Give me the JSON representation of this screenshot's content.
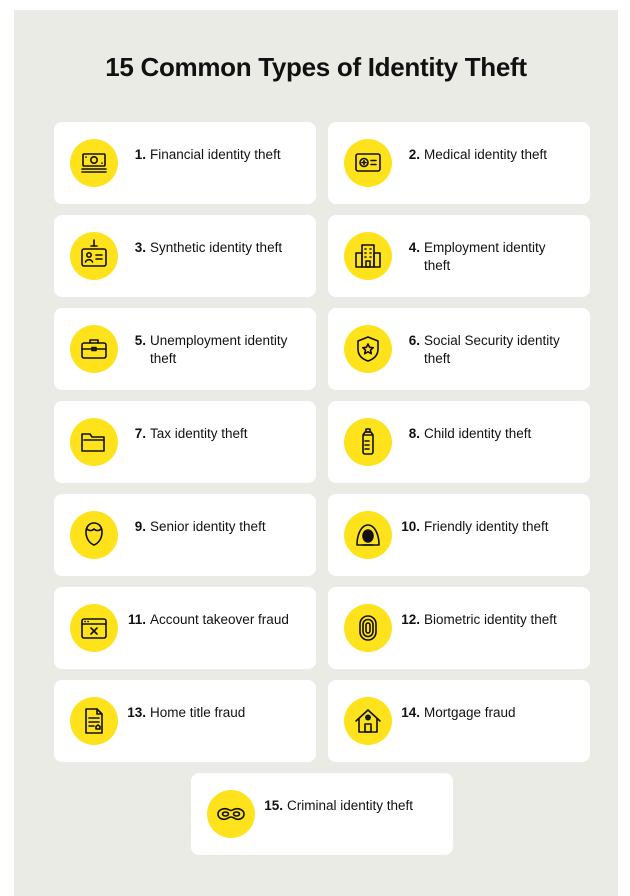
{
  "title": "15 Common Types of Identity Theft",
  "accent_color": "#fde21c",
  "items": [
    {
      "num": "1.",
      "label": "Financial identity theft",
      "icon": "banknote-icon"
    },
    {
      "num": "2.",
      "label": "Medical identity theft",
      "icon": "medical-card-icon"
    },
    {
      "num": "3.",
      "label": "Synthetic identity theft",
      "icon": "id-badge-icon"
    },
    {
      "num": "4.",
      "label": "Employment identity theft",
      "icon": "office-building-icon"
    },
    {
      "num": "5.",
      "label": "Unemployment identity theft",
      "icon": "briefcase-icon"
    },
    {
      "num": "6.",
      "label": "Social Security identity theft",
      "icon": "shield-star-icon"
    },
    {
      "num": "7.",
      "label": "Tax identity theft",
      "icon": "folder-icon"
    },
    {
      "num": "8.",
      "label": "Child identity theft",
      "icon": "baby-bottle-icon"
    },
    {
      "num": "9.",
      "label": "Senior identity theft",
      "icon": "senior-head-icon"
    },
    {
      "num": "10.",
      "label": "Friendly identity theft",
      "icon": "hooded-person-icon"
    },
    {
      "num": "11.",
      "label": "Account takeover fraud",
      "icon": "browser-window-x-icon"
    },
    {
      "num": "12.",
      "label": "Biometric identity theft",
      "icon": "fingerprint-icon"
    },
    {
      "num": "13.",
      "label": "Home title fraud",
      "icon": "deed-document-icon"
    },
    {
      "num": "14.",
      "label": "Mortgage fraud",
      "icon": "house-icon"
    },
    {
      "num": "15.",
      "label": "Criminal identity theft",
      "icon": "bandit-mask-icon"
    }
  ]
}
